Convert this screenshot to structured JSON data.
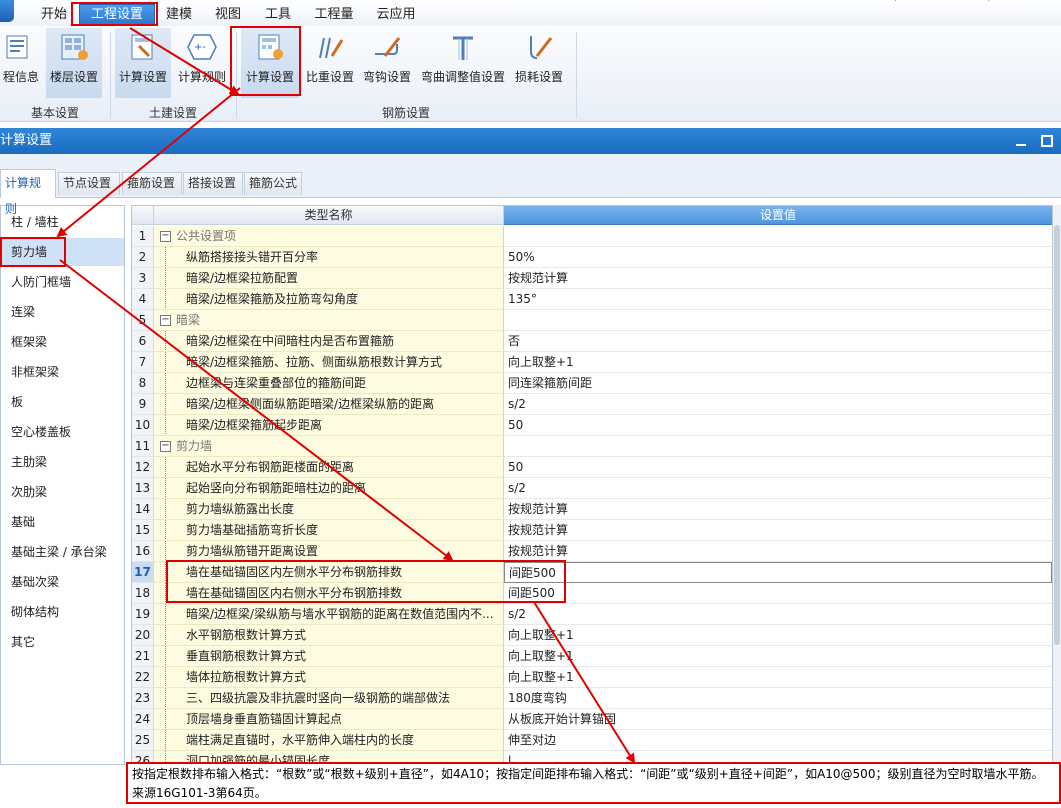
{
  "menubar": {
    "items": [
      "开始",
      "工程设置",
      "建模",
      "视图",
      "工具",
      "工程量",
      "云应用"
    ]
  },
  "ribbon": {
    "buttons": [
      {
        "label": "程信息",
        "icon": "project-info-icon"
      },
      {
        "label": "楼层设置",
        "icon": "floor-settings-icon"
      },
      {
        "label": "计算设置",
        "icon": "civil-calc-settings-icon"
      },
      {
        "label": "计算规则",
        "icon": "calc-rules-icon"
      },
      {
        "label": "计算设置",
        "icon": "rebar-calc-settings-icon"
      },
      {
        "label": "比重设置",
        "icon": "density-settings-icon"
      },
      {
        "label": "弯钩设置",
        "icon": "hook-settings-icon"
      },
      {
        "label": "弯曲调整值设置",
        "icon": "bend-adjust-icon"
      },
      {
        "label": "损耗设置",
        "icon": "loss-settings-icon"
      }
    ],
    "groups": [
      "基本设置",
      "土建设置",
      "钢筋设置"
    ]
  },
  "dialog": {
    "title": "计算设置"
  },
  "tabs": [
    "计算规则",
    "节点设置",
    "箍筋设置",
    "搭接设置",
    "箍筋公式"
  ],
  "left_list": [
    "柱 / 墙柱",
    "剪力墙",
    "人防门框墙",
    "连梁",
    "框架梁",
    "非框架梁",
    "板",
    "空心楼盖板",
    "主肋梁",
    "次肋梁",
    "基础",
    "基础主梁 / 承台梁",
    "基础次梁",
    "砌体结构",
    "其它"
  ],
  "grid": {
    "header_name": "类型名称",
    "header_value": "设置值",
    "rows": [
      {
        "num": "1",
        "name": "公共设置项",
        "value": "",
        "group": true
      },
      {
        "num": "2",
        "name": "纵筋搭接接头错开百分率",
        "value": "50%"
      },
      {
        "num": "3",
        "name": "暗梁/边框梁拉筋配置",
        "value": "按规范计算"
      },
      {
        "num": "4",
        "name": "暗梁/边框梁箍筋及拉筋弯勾角度",
        "value": "135°"
      },
      {
        "num": "5",
        "name": "暗梁",
        "value": "",
        "group": true
      },
      {
        "num": "6",
        "name": "暗梁/边框梁在中间暗柱内是否布置箍筋",
        "value": "否"
      },
      {
        "num": "7",
        "name": "暗梁/边框梁箍筋、拉筋、侧面纵筋根数计算方式",
        "value": "向上取整+1"
      },
      {
        "num": "8",
        "name": "边框梁与连梁重叠部位的箍筋间距",
        "value": "同连梁箍筋间距"
      },
      {
        "num": "9",
        "name": "暗梁/边框梁侧面纵筋距暗梁/边框梁纵筋的距离",
        "value": "s/2"
      },
      {
        "num": "10",
        "name": "暗梁/边框梁箍筋起步距离",
        "value": "50"
      },
      {
        "num": "11",
        "name": "剪力墙",
        "value": "",
        "group": true
      },
      {
        "num": "12",
        "name": "起始水平分布钢筋距楼面的距离",
        "value": "50"
      },
      {
        "num": "13",
        "name": "起始竖向分布钢筋距暗柱边的距离",
        "value": "s/2"
      },
      {
        "num": "14",
        "name": "剪力墙纵筋露出长度",
        "value": "按规范计算"
      },
      {
        "num": "15",
        "name": "剪力墙基础插筋弯折长度",
        "value": "按规范计算"
      },
      {
        "num": "16",
        "name": "剪力墙纵筋错开距离设置",
        "value": "按规范计算"
      },
      {
        "num": "17",
        "name": "墙在基础锚固区内左侧水平分布钢筋排数",
        "value": "间距500",
        "selected": true
      },
      {
        "num": "18",
        "name": "墙在基础锚固区内右侧水平分布钢筋排数",
        "value": "间距500"
      },
      {
        "num": "19",
        "name": "暗梁/边框梁/梁纵筋与墙水平钢筋的距离在数值范围内不...",
        "value": "s/2"
      },
      {
        "num": "20",
        "name": "水平钢筋根数计算方式",
        "value": "向上取整+1"
      },
      {
        "num": "21",
        "name": "垂直钢筋根数计算方式",
        "value": "向上取整+1"
      },
      {
        "num": "22",
        "name": "墙体拉筋根数计算方式",
        "value": "向上取整+1"
      },
      {
        "num": "23",
        "name": "三、四级抗震及非抗震时竖向一级钢筋的端部做法",
        "value": "180度弯钩"
      },
      {
        "num": "24",
        "name": "顶层墙身垂直筋锚固计算起点",
        "value": "从板底开始计算锚固"
      },
      {
        "num": "25",
        "name": "端柱满足直锚时，水平筋伸入端柱内的长度",
        "value": "伸至对边"
      },
      {
        "num": "26",
        "name": "洞口加强筋的最小锚固长度",
        "value": "l"
      }
    ]
  },
  "hint": "按指定根数排布输入格式：“根数”或“根数+级别+直径”，如4A10；按指定间距排布输入格式：“间距”或“级别+直径+间距”，如A10@500；级别直径为空时取墙水平筋。来源16G101-3第64页。",
  "colors": {
    "annotation_red": "#e00000",
    "accent_blue": "#2a77cf",
    "name_cell_bg": "#fdfbe0"
  }
}
